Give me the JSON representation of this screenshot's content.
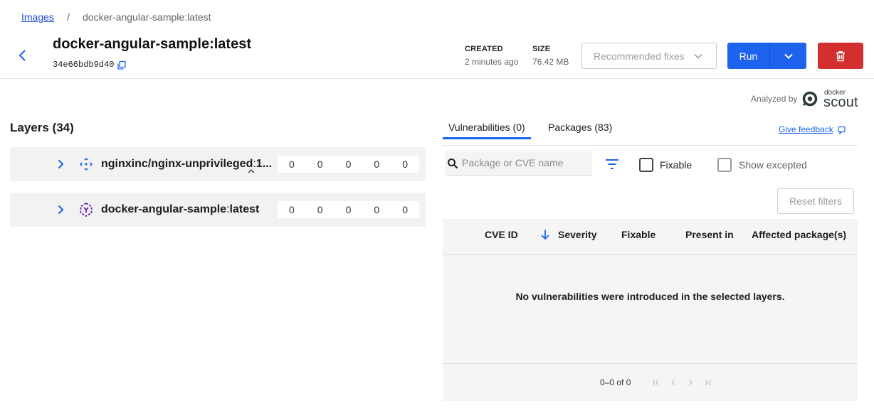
{
  "breadcrumb": {
    "root": "Images",
    "separator": "/",
    "current": "docker-angular-sample:latest"
  },
  "header": {
    "title": "docker-angular-sample:latest",
    "digest": "34e66bdb9d40",
    "created_label": "CREATED",
    "created_value": "2 minutes ago",
    "size_label": "SIZE",
    "size_value": "76.42 MB",
    "fixes_label": "Recommended fixes",
    "run_label": "Run"
  },
  "scout": {
    "analyzed_by": "Analyzed by",
    "brand_small": "docker",
    "brand_big": "scout"
  },
  "layers": {
    "title": "Layers (34)",
    "items": [
      {
        "name": "nginxinc/nginx-unprivileged",
        "sep": ":",
        "tag": "1...",
        "icon": "base-image-icon",
        "counts": [
          "0",
          "0",
          "0",
          "0",
          "0"
        ]
      },
      {
        "name": "docker-angular-sample",
        "sep": ":",
        "tag": "latest",
        "icon": "image-layers-icon",
        "counts": [
          "0",
          "0",
          "0",
          "0",
          "0"
        ]
      }
    ]
  },
  "tabs": [
    {
      "label": "Vulnerabilities (0)",
      "active": true
    },
    {
      "label": "Packages (83)",
      "active": false
    }
  ],
  "feedback_label": "Give feedback",
  "filters": {
    "search_placeholder": "Package or CVE name",
    "fixable_label": "Fixable",
    "show_excepted_label": "Show excepted",
    "reset_label": "Reset filters"
  },
  "table": {
    "columns": [
      "CVE ID",
      "Severity",
      "Fixable",
      "Present in",
      "Affected package(s)"
    ],
    "empty_message": "No vulnerabilities were introduced in the selected layers.",
    "pagination": "0–0 of 0"
  },
  "colors": {
    "primary": "#1d63ed",
    "danger": "#d32f2f",
    "layer_icon": "#6a1fb5",
    "base_icon": "#1d63ed"
  }
}
